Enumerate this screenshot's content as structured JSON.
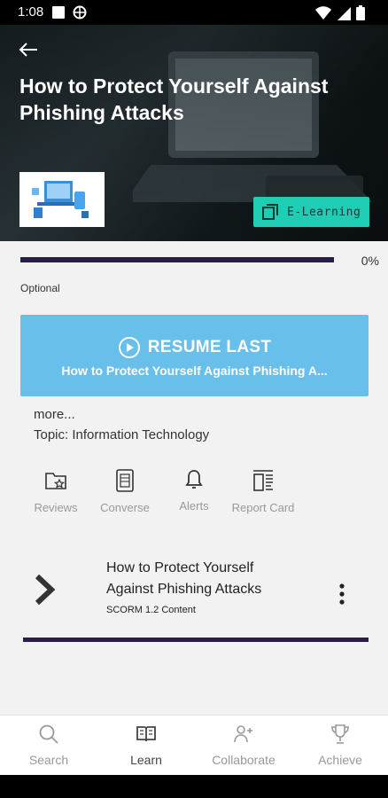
{
  "status_bar": {
    "time": "1:08"
  },
  "header": {
    "title": "How to Protect Yourself Against Phishing Attacks",
    "badge_label": "E-Learning"
  },
  "progress": {
    "value": 0,
    "percent_label": "0%"
  },
  "optional_label": "Optional",
  "resume": {
    "label": "RESUME LAST",
    "subtitle": "How to Protect Yourself Against Phishing A..."
  },
  "details": {
    "more": "more...",
    "topic": "Topic: Information Technology"
  },
  "actions": [
    {
      "label": "Reviews",
      "icon": "folder-star-icon"
    },
    {
      "label": "Converse",
      "icon": "document-icon"
    },
    {
      "label": "Alerts",
      "icon": "bell-icon"
    },
    {
      "label": "Report Card",
      "icon": "report-card-icon"
    }
  ],
  "content_item": {
    "title": "How to Protect Yourself Against Phishing Attacks",
    "type": "SCORM 1.2 Content"
  },
  "bottom_nav": [
    {
      "label": "Search",
      "icon": "search-icon"
    },
    {
      "label": "Learn",
      "icon": "book-icon",
      "active": true
    },
    {
      "label": "Collaborate",
      "icon": "person-add-icon"
    },
    {
      "label": "Achieve",
      "icon": "trophy-icon"
    }
  ],
  "colors": {
    "accent": "#68bfe9",
    "badge": "#1fcdb4",
    "progress_track": "#2b1d45"
  }
}
